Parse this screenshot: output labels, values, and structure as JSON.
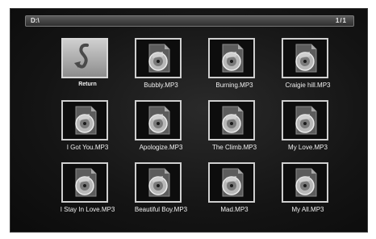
{
  "pathbar": {
    "path": "D:\\",
    "page": "1/1"
  },
  "items": [
    {
      "label": "Return",
      "type": "return"
    },
    {
      "label": "Bubbly.MP3",
      "type": "music"
    },
    {
      "label": "Burning.MP3",
      "type": "music"
    },
    {
      "label": "Craigie hill.MP3",
      "type": "music"
    },
    {
      "label": "I Got You.MP3",
      "type": "music"
    },
    {
      "label": "Apologize.MP3",
      "type": "music"
    },
    {
      "label": "The Climb.MP3",
      "type": "music"
    },
    {
      "label": "My Love.MP3",
      "type": "music"
    },
    {
      "label": "I Stay In Love.MP3",
      "type": "music"
    },
    {
      "label": "Beautiful Boy.MP3",
      "type": "music"
    },
    {
      "label": "Mad.MP3",
      "type": "music"
    },
    {
      "label": "My All.MP3",
      "type": "music"
    }
  ],
  "icons": {
    "return": "return-arrow-icon",
    "music": "music-file-icon"
  },
  "colors": {
    "background": "#141414",
    "frame": "#cfcfcf",
    "text": "#f0f0f0"
  }
}
